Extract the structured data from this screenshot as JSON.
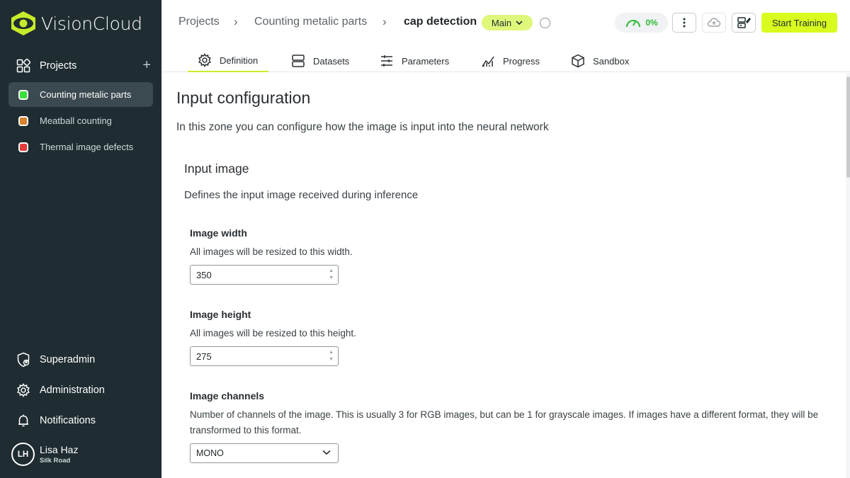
{
  "app": {
    "name": "VisionCloud"
  },
  "sidebar": {
    "projects_label": "Projects",
    "add_symbol": "+",
    "projects": [
      {
        "name": "Counting metalic parts",
        "color": "#39e03c",
        "active": true
      },
      {
        "name": "Meatball counting",
        "color": "#d9822b",
        "active": false
      },
      {
        "name": "Thermal image defects",
        "color": "#e63b3b",
        "active": false
      }
    ],
    "bottom": [
      {
        "label": "Superadmin",
        "icon": "shield-user-icon"
      },
      {
        "label": "Administration",
        "icon": "gear-icon"
      },
      {
        "label": "Notifications",
        "icon": "bell-icon"
      }
    ],
    "user": {
      "initials": "LH",
      "name": "Lisa Haz",
      "org": "Silk Road"
    }
  },
  "header": {
    "breadcrumb": [
      "Projects",
      "Counting metalic parts",
      "cap detection"
    ],
    "branch": "Main",
    "progress_pct": "0%",
    "start_training": "Start Training",
    "tabs": [
      {
        "label": "Definition",
        "icon": "gear-icon",
        "active": true
      },
      {
        "label": "Datasets",
        "icon": "database-icon",
        "active": false
      },
      {
        "label": "Parameters",
        "icon": "sliders-icon",
        "active": false
      },
      {
        "label": "Progress",
        "icon": "chart-icon",
        "active": false
      },
      {
        "label": "Sandbox",
        "icon": "cube-icon",
        "active": false
      }
    ]
  },
  "content": {
    "title": "Input configuration",
    "lead": "In this zone you can configure how the image is input into the neural network",
    "section_title": "Input image",
    "section_desc": "Defines the input image received during inference",
    "fields": {
      "width": {
        "label": "Image width",
        "help": "All images will be resized to this width.",
        "value": "350"
      },
      "height": {
        "label": "Image height",
        "help": "All images will be resized to this height.",
        "value": "275"
      },
      "channels": {
        "label": "Image channels",
        "help": "Number of channels of the image. This is usually 3 for RGB images, but can be 1 for grayscale images. If images have a different format, they will be transformed to this format.",
        "value": "MONO"
      }
    }
  },
  "colors": {
    "accent": "#d9fb1e",
    "sidebar_bg": "#1f2d32",
    "progress": "#2fba37"
  }
}
